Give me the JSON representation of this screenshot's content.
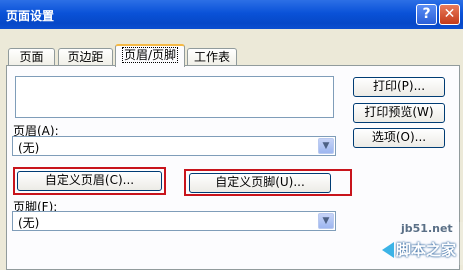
{
  "window": {
    "title": "页面设置",
    "help_label": "?",
    "close_label": "✕"
  },
  "tabs": [
    {
      "label": "页面"
    },
    {
      "label": "页边距"
    },
    {
      "label": "页眉/页脚",
      "active": true
    },
    {
      "label": "工作表"
    }
  ],
  "header": {
    "label": "页眉(A):",
    "value": "(无)",
    "custom_button": "自定义页眉(C)..."
  },
  "footer": {
    "label": "页脚(F):",
    "value": "(无)",
    "custom_button": "自定义页脚(U)..."
  },
  "side_buttons": {
    "print": "打印(P)...",
    "print_preview": "打印预览(W)",
    "options": "选项(O)..."
  },
  "watermark": {
    "site": "jb51.net",
    "text": "脚本之家"
  },
  "colors": {
    "highlight_box": "#c8141c",
    "titlebar": "#0a52d8"
  }
}
